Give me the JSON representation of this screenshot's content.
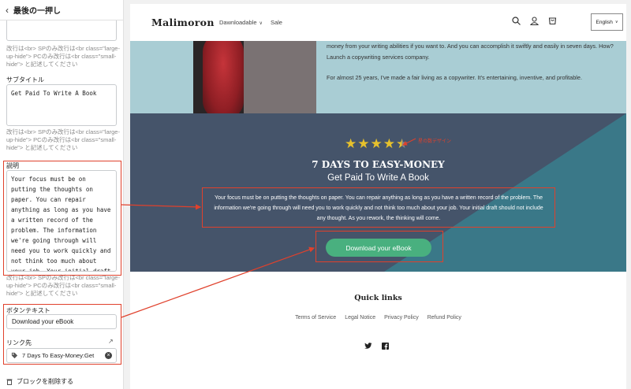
{
  "panel": {
    "back_icon": "chevron-left-icon",
    "title": "最後の一押し",
    "hint_1": "改行は<br> SPのみ改行は<br class=\"large-up-hide\"> PCのみ改行は<br class=\"small-hide\"> と記述してください",
    "subtitle_label": "サブタイトル",
    "subtitle_value": "Get Paid To Write A Book",
    "hint_2": "改行は<br> SPのみ改行は<br class=\"large-up-hide\"> PCのみ改行は<br class=\"small-hide\"> と記述してください",
    "description_label": "説明",
    "description_value": "Your focus must be on putting the thoughts on paper. You can repair anything as long as you have a written record of the problem. The information we're going through will need you to work quickly and not think too much about your job. Your initial draft",
    "hint_3": "改行は<br> SPのみ改行は<br class=\"large-up-hide\"> PCのみ改行は<br class=\"small-hide\"> と記述してください",
    "button_text_label": "ボタンテキスト",
    "button_text_value": "Download your eBook",
    "link_label": "リンク先",
    "link_value": "7 Days To Easy-Money:Get",
    "delete_label": "ブロックを削除する"
  },
  "store": {
    "logo": "Malimoron",
    "nav": [
      {
        "label": "Dawnloadable",
        "has_dropdown": true
      },
      {
        "label": "Sale",
        "has_dropdown": false
      }
    ],
    "language": "English",
    "about_paragraphs": [
      "money from your writing abilities if you want to. And you can accomplish it swiftly and easily in seven days. How? Launch a copywriting services company.",
      "For almost 25 years, I've made a fair living as a copywriter. It's entertaining, inventive, and profitable."
    ],
    "hero": {
      "rating": 4.5,
      "rating_note": "星の数デザイン",
      "title": "7 DAYS TO EASY-MONEY",
      "subtitle": "Get Paid To Write A Book",
      "description": "Your focus must be on putting the thoughts on paper. You can repair anything as long as you have a written record of the problem. The information we're going through will need you to work quickly and not think too much about your job. Your initial draft should not include any thought. As you rework, the thinking will come.",
      "button_label": "Download your eBook"
    },
    "footer": {
      "title": "Quick links",
      "links": [
        "Terms of Service",
        "Legal Notice",
        "Privacy Policy",
        "Refund Policy"
      ],
      "social": [
        "twitter-icon",
        "facebook-icon"
      ]
    }
  },
  "colors": {
    "accent_green": "#49b07f",
    "annotation_red": "#e0412c",
    "hero_bg": "#45546a",
    "about_bg": "#a9cdd4",
    "star": "#e6c12c"
  }
}
